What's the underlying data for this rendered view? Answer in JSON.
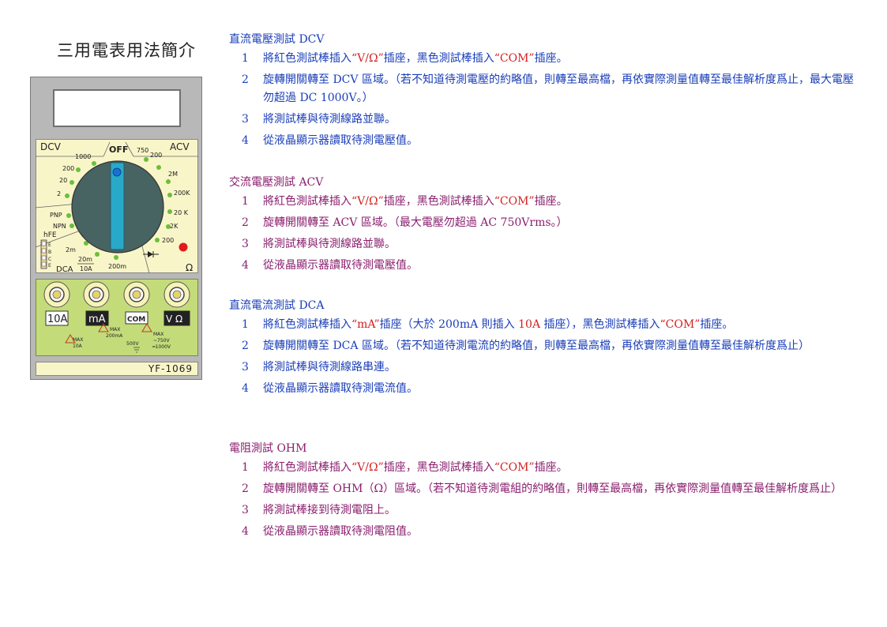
{
  "page_title": "三用電表用法簡介",
  "meter": {
    "labels": {
      "dcv": "DCV",
      "acv": "ACV",
      "off": "OFF",
      "hfe": "hFE",
      "pnp": "PNP",
      "npn": "NPN",
      "dca": "DCA",
      "ohm": "Ω",
      "e": "E",
      "b": "B",
      "c": "C",
      "r1000": "1000",
      "r200": "200",
      "r20": "20",
      "r2": "2",
      "r750": "750",
      "r200ac": "200",
      "r2M": "2M",
      "r200K": "200K",
      "r20K": "20 K",
      "r2K": "2K",
      "r200ohm": "200",
      "r2m": "2m",
      "r20m": "20m",
      "r10A": "10A",
      "r200m": "200m"
    },
    "jacks": [
      "10A",
      "mA",
      "COM",
      "V Ω"
    ],
    "warnings": {
      "w1_max": "MAX",
      "w1_val": "10A",
      "w2_max": "MAX",
      "w2_val": "200mA",
      "w3_val": "500V",
      "w4_max": "MAX",
      "w4_ac": "~750V",
      "w4_dc": "═1000V"
    },
    "model": "YF-1069"
  },
  "sections": [
    {
      "title": "直流電壓測試 DCV",
      "steps": [
        {
          "num": "1",
          "parts": [
            "將紅色測試棒插入",
            "“V/Ω”",
            "插座，黑色測試棒插入",
            "“COM”",
            "插座。"
          ]
        },
        {
          "num": "2",
          "text": "旋轉開關轉至 DCV 區域。（若不知道待測電壓的約略值，則轉至最高檔，再依實際測量值轉至最佳解析度爲止，最大電壓勿超過 DC 1000V。）"
        },
        {
          "num": "3",
          "text": "將測試棒與待測線路並聯。"
        },
        {
          "num": "4",
          "text": "從液晶顯示器讀取待測電壓值。"
        }
      ]
    },
    {
      "title": "交流電壓測試 ACV",
      "steps": [
        {
          "num": "1",
          "parts": [
            "將紅色測試棒插入",
            "“V/Ω”",
            "插座，黑色測試棒插入",
            "“COM”",
            "插座。"
          ]
        },
        {
          "num": "2",
          "text": "旋轉開關轉至 ACV 區域。（最大電壓勿超過 AC 750Vrms。）"
        },
        {
          "num": "3",
          "text": "將測試棒與待測線路並聯。"
        },
        {
          "num": "4",
          "text": "從液晶顯示器讀取待測電壓值。"
        }
      ]
    },
    {
      "title": "直流電流測試 DCA",
      "steps": [
        {
          "num": "1",
          "parts": [
            "將紅色測試棒插入",
            "“mA”",
            "插座（大於 200mA 則插入",
            "10A",
            "插座），黑色測試棒插入",
            "“COM”",
            "插座。"
          ]
        },
        {
          "num": "2",
          "text": "旋轉開關轉至 DCA 區域。（若不知道待測電流的約略值，則轉至最高檔，再依實際測量值轉至最佳解析度爲止）"
        },
        {
          "num": "3",
          "text": "將測試棒與待測線路串連。"
        },
        {
          "num": "4",
          "text": "從液晶顯示器讀取待測電流值。"
        }
      ]
    },
    {
      "title": "電阻測試 OHM",
      "steps": [
        {
          "num": "1",
          "parts": [
            "將紅色測試棒插入",
            "“V/Ω”",
            "插座，黑色測試棒插入",
            "“COM”",
            "插座。"
          ]
        },
        {
          "num": "2",
          "text": "旋轉開關轉至 OHM（Ω）區域。（若不知道待測電組的約略值，則轉至最高檔，再依實際測量值轉至最佳解析度爲止）"
        },
        {
          "num": "3",
          "text": "將測試棒接到待測電阻上。"
        },
        {
          "num": "4",
          "text": "從液晶顯示器讀取待測電阻值。"
        }
      ]
    }
  ]
}
